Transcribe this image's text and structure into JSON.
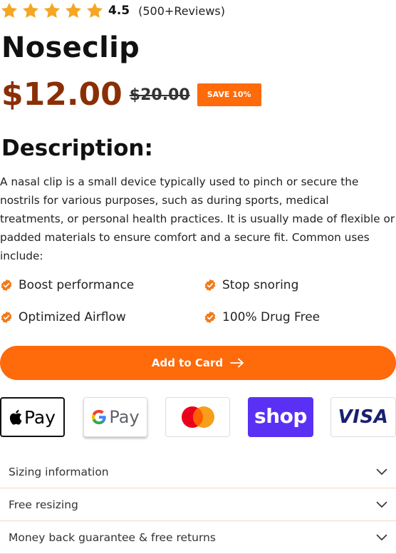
{
  "rating": {
    "value": "4.5",
    "count": "(500+Reviews)",
    "stars_filled": 5
  },
  "product": {
    "title": "Noseclip",
    "price": "$12.00",
    "old_price": "$20.00",
    "save_badge": "SAVE 10%"
  },
  "description": {
    "heading": "Description:",
    "text": "A nasal clip is a small device typically used to pinch or secure the nostrils for various purposes, such as during sports, medical treatments, or personal health practices. It is usually made of flexible or padded materials to ensure comfort and a secure fit. Common uses include:"
  },
  "features": [
    "Boost performance",
    "Stop snoring",
    "Optimized Airflow",
    "100% Drug Free"
  ],
  "cart_button": {
    "label": "Add to Card"
  },
  "payments": {
    "apple": "Pay",
    "google": "Pay",
    "shop": "shop",
    "visa": "VISA"
  },
  "accordion": [
    "Sizing information",
    "Free resizing",
    "Money back guarantee & free returns"
  ],
  "colors": {
    "accent": "#ff6a0a",
    "price": "#8a2f05",
    "star": "#f5a623",
    "shop": "#5a31f4",
    "visa": "#1a1f71"
  }
}
